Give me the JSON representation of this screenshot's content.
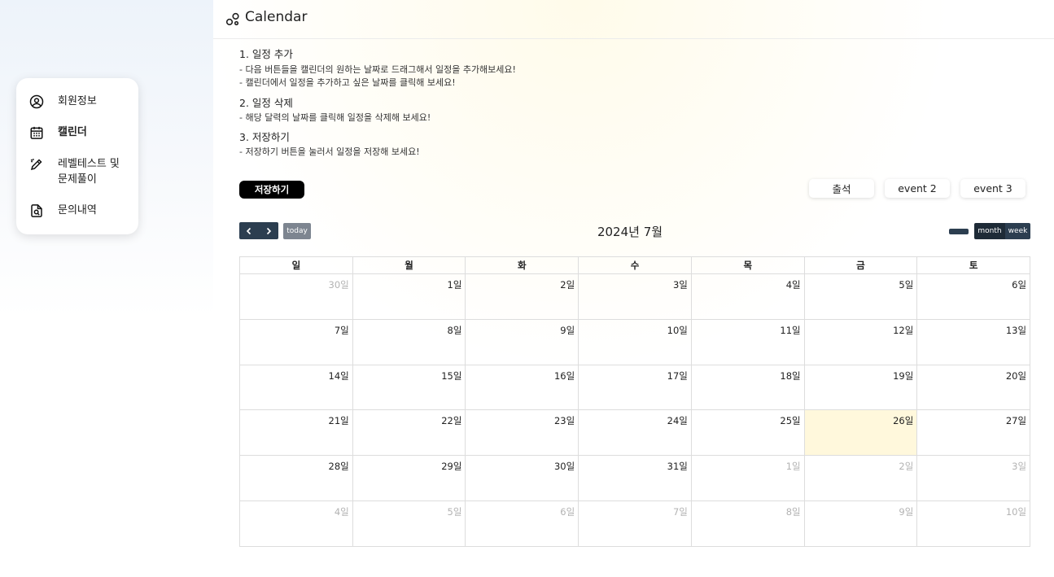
{
  "header": {
    "title": "Calendar"
  },
  "sidebar": {
    "items": [
      {
        "label": "회원정보",
        "icon": "user-circle-icon"
      },
      {
        "label": "캘린더",
        "icon": "calendar-icon",
        "active": true
      },
      {
        "label": "레벨테스트 및 문제풀이",
        "icon": "pen-icon"
      },
      {
        "label": "문의내역",
        "icon": "document-search-icon"
      }
    ]
  },
  "instructions": {
    "s1_title": "1. 일정 추가",
    "s1_line1": "- 다음 버튼들을 캘린더의 원하는 날짜로 드래그해서 일정을 추가해보세요!",
    "s1_line2": "- 캘린더에서 일정을 추가하고 싶은 날짜를 클릭해 보세요!",
    "s2_title": "2. 일정 삭제",
    "s2_line1": "- 해당 달력의 날짜를 클릭해 일정을 삭제해 보세요!",
    "s3_title": "3. 저장하기",
    "s3_line1": "- 저장하기 버튼을 눌러서 일정을 저장해 보세요!"
  },
  "buttons": {
    "save": "저장하기",
    "event1": "출석",
    "event2": "event 2",
    "event3": "event 3"
  },
  "toolbar": {
    "today": "today",
    "title": "2024년 7월",
    "month": "month",
    "week": "week"
  },
  "calendar": {
    "weekdays": [
      "일",
      "월",
      "화",
      "수",
      "목",
      "금",
      "토"
    ],
    "weeks": [
      [
        {
          "d": "30일",
          "o": true
        },
        {
          "d": "1일"
        },
        {
          "d": "2일"
        },
        {
          "d": "3일"
        },
        {
          "d": "4일"
        },
        {
          "d": "5일"
        },
        {
          "d": "6일"
        }
      ],
      [
        {
          "d": "7일"
        },
        {
          "d": "8일"
        },
        {
          "d": "9일"
        },
        {
          "d": "10일"
        },
        {
          "d": "11일"
        },
        {
          "d": "12일"
        },
        {
          "d": "13일"
        }
      ],
      [
        {
          "d": "14일"
        },
        {
          "d": "15일"
        },
        {
          "d": "16일"
        },
        {
          "d": "17일"
        },
        {
          "d": "18일"
        },
        {
          "d": "19일"
        },
        {
          "d": "20일"
        }
      ],
      [
        {
          "d": "21일"
        },
        {
          "d": "22일"
        },
        {
          "d": "23일"
        },
        {
          "d": "24일"
        },
        {
          "d": "25일"
        },
        {
          "d": "26일",
          "t": true
        },
        {
          "d": "27일"
        }
      ],
      [
        {
          "d": "28일"
        },
        {
          "d": "29일"
        },
        {
          "d": "30일"
        },
        {
          "d": "31일"
        },
        {
          "d": "1일",
          "o": true
        },
        {
          "d": "2일",
          "o": true
        },
        {
          "d": "3일",
          "o": true
        }
      ],
      [
        {
          "d": "4일",
          "o": true
        },
        {
          "d": "5일",
          "o": true
        },
        {
          "d": "6일",
          "o": true
        },
        {
          "d": "7일",
          "o": true
        },
        {
          "d": "8일",
          "o": true
        },
        {
          "d": "9일",
          "o": true
        },
        {
          "d": "10일",
          "o": true
        }
      ]
    ]
  },
  "colors": {
    "accent": "#2c3e50",
    "today_bg": "#fff8dc",
    "save_bg": "#000000"
  }
}
